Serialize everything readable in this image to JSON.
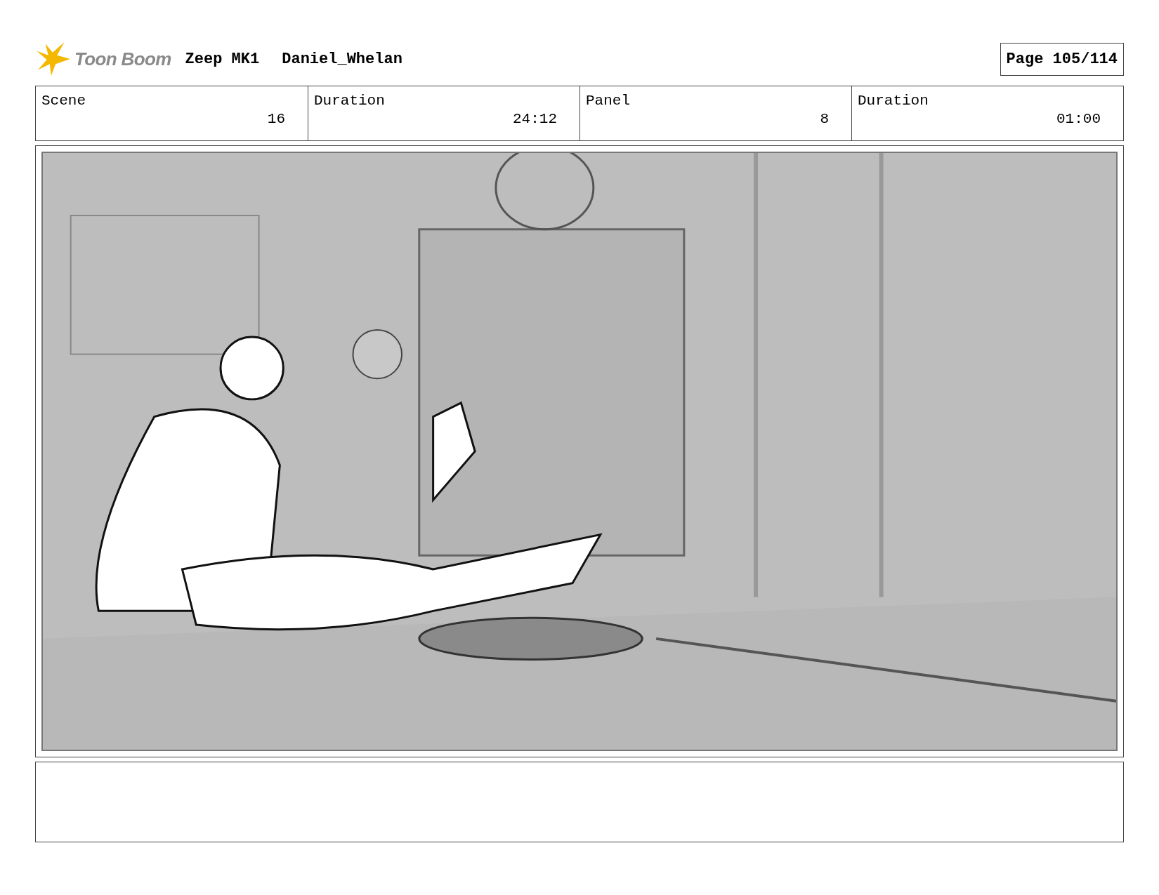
{
  "header": {
    "logo_text": "Toon Boom",
    "project": "Zeep MK1",
    "artist": "Daniel_Whelan",
    "page": "Page 105/114"
  },
  "fields": [
    {
      "label": "Scene",
      "value": "16"
    },
    {
      "label": "Duration",
      "value": "24:12"
    },
    {
      "label": "Panel",
      "value": "8"
    },
    {
      "label": "Duration",
      "value": "01:00"
    }
  ]
}
